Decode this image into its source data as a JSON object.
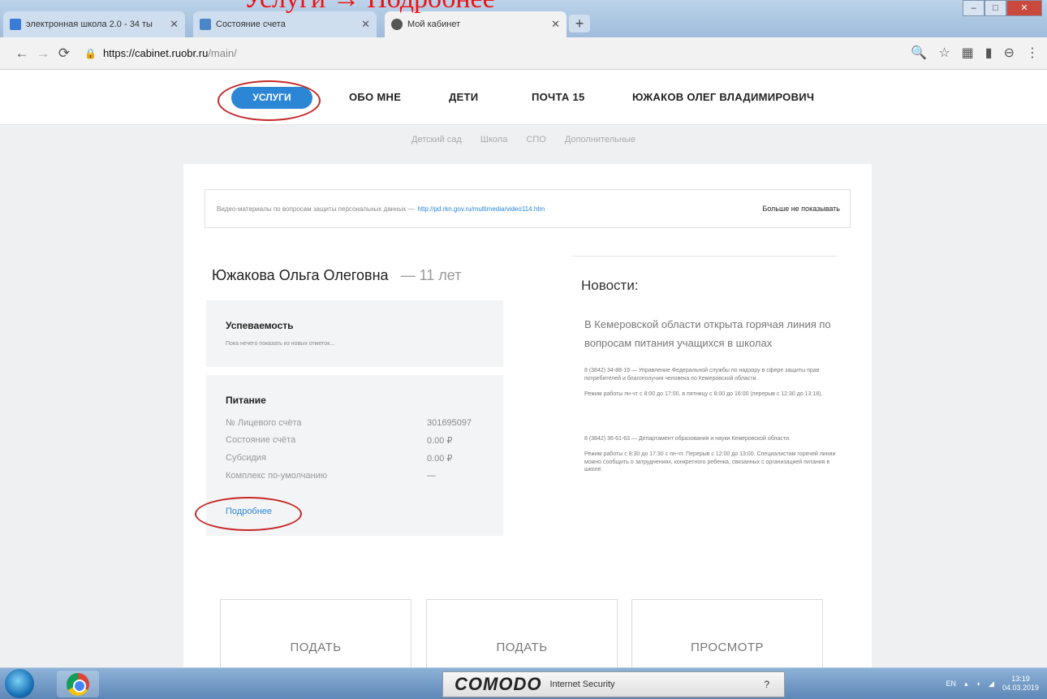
{
  "browser": {
    "tabs": [
      {
        "label": "электронная школа 2.0 - 34 ты",
        "active": false
      },
      {
        "label": "Состояние счета",
        "active": false
      },
      {
        "label": "Мой кабинет",
        "active": true
      }
    ],
    "url_host": "https://cabinet.ruobr.ru",
    "url_path": "/main/"
  },
  "nav": {
    "services": "УСЛУГИ",
    "about": "ОБО МНЕ",
    "children": "ДЕТИ",
    "mail": "ПОЧТА 15",
    "user": "ЮЖАКОВ ОЛЕГ ВЛАДИМИРОВИЧ"
  },
  "subnav": [
    "Детский сад",
    "Школа",
    "СПО",
    "Дополнительные"
  ],
  "notice": {
    "text": "Видео-материалы по вопросам защиты персональных данных —",
    "link": "http://pd.rkn.gov.ru/multimedia/video114.htm",
    "hide": "Больше не показывать"
  },
  "child": {
    "name": "Южакова Ольга Олеговна",
    "dash": "—",
    "age": "11 лет"
  },
  "progress": {
    "title": "Успеваемость",
    "subtitle": "Пока нечего показать из новых отметок..."
  },
  "nutrition": {
    "title": "Питание",
    "rows": [
      {
        "label": "№ Лицевого счёта",
        "value": "301695097"
      },
      {
        "label": "Состояние счёта",
        "value": "0.00 ₽"
      },
      {
        "label": "Субсидия",
        "value": "0.00 ₽"
      },
      {
        "label": "Комплекс по-умолчанию",
        "value": "—"
      }
    ],
    "more": "Подробнее"
  },
  "news": {
    "title": "Новости:",
    "headline": "В Кемеровской области открыта горячая линия по вопросам питания учащихся в школах",
    "p1": "8 (3842) 34-88-19 — Управление Федеральной службы по надзору в сфере защиты прав потребителей и благополучия человека по Кемеровской области.",
    "p1_hours": "Режим работы пн-чт с 8:00 до 17:00, в пятницу с 8:00 до 16:00 (перерыв с 12:30 до 13:18).",
    "p2": "8 (3842) 36-61-63 — Департамент образования и науки Кемеровской области.",
    "p2_hours": "Режим работы с 8:30 до 17:30 с пн-чт. Перерыв с 12:00 до 13:00. Специалистам горячей линии можно сообщить о затруднениях, конкретного ребенка, связанных с организацией питания в школе."
  },
  "actions": [
    "ПОДАТЬ",
    "ПОДАТЬ",
    "ПРОСМОТР"
  ],
  "heading": "Услуги → Подробнее",
  "taskbar": {
    "comodo_brand": "COMODO",
    "comodo_product": "Internet Security",
    "comodo_help": "?",
    "lang": "EN",
    "time": "13:19",
    "date": "04.03.2019"
  },
  "colors": {
    "accent": "#2b86d6",
    "annotation": "#c62828",
    "heading": "#ee1111"
  }
}
